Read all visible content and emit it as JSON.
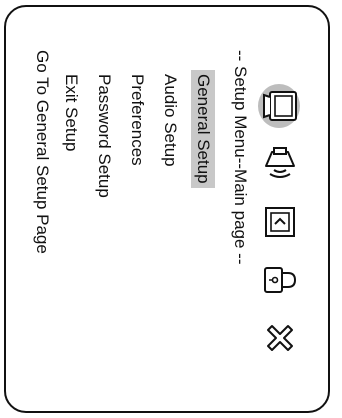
{
  "header": {
    "title": "-- Setup Menu--Main page --"
  },
  "toolbar": {
    "icons": [
      {
        "name": "general-setup-icon",
        "selected": true
      },
      {
        "name": "audio-setup-icon",
        "selected": false
      },
      {
        "name": "preferences-icon",
        "selected": false
      },
      {
        "name": "password-lock-icon",
        "selected": false
      },
      {
        "name": "exit-icon",
        "selected": false
      }
    ]
  },
  "menu": {
    "selected_index": 0,
    "items": [
      {
        "label": "General Setup"
      },
      {
        "label": "Audio Setup"
      },
      {
        "label": "Preferences"
      },
      {
        "label": "Password Setup"
      },
      {
        "label": "Exit Setup"
      }
    ]
  },
  "status": {
    "hint": "Go To General Setup Page"
  },
  "colors": {
    "highlight": "#c8c8c8",
    "text": "#111111",
    "border": "#111111"
  }
}
